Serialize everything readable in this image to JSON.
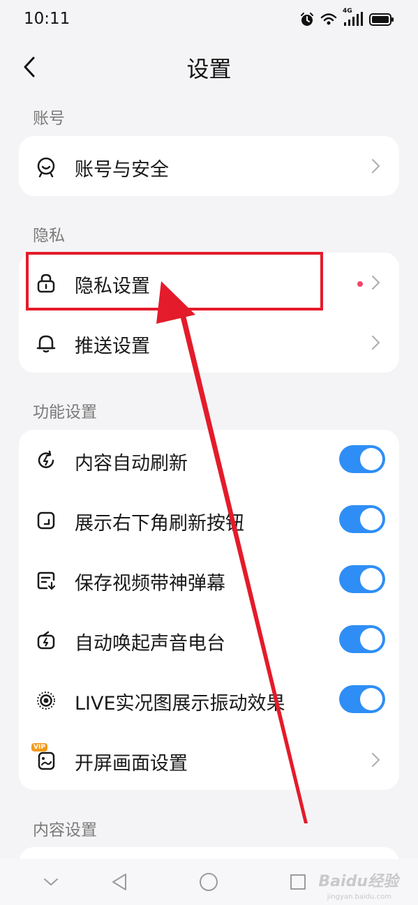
{
  "status_bar": {
    "time": "10:11",
    "network": "4G",
    "icons": [
      "alarm-icon",
      "wifi-icon",
      "signal-icon",
      "battery-icon"
    ]
  },
  "header": {
    "title": "设置",
    "back_icon": "back-arrow-icon"
  },
  "sections": {
    "account": {
      "label": "账号",
      "items": [
        {
          "label": "账号与安全",
          "icon": "face-id-icon",
          "control": "chevron"
        }
      ]
    },
    "privacy": {
      "label": "隐私",
      "items": [
        {
          "label": "隐私设置",
          "icon": "lock-icon",
          "control": "chevron",
          "badge": "red-dot"
        },
        {
          "label": "推送设置",
          "icon": "bell-icon",
          "control": "chevron"
        }
      ]
    },
    "features": {
      "label": "功能设置",
      "items": [
        {
          "label": "内容自动刷新",
          "icon": "refresh-icon",
          "control": "toggle",
          "on": true
        },
        {
          "label": "展示右下角刷新按钮",
          "icon": "corner-button-icon",
          "control": "toggle",
          "on": true
        },
        {
          "label": "保存视频带神弹幕",
          "icon": "danmaku-icon",
          "control": "toggle",
          "on": true
        },
        {
          "label": "自动唤起声音电台",
          "icon": "radio-icon",
          "control": "toggle",
          "on": true
        },
        {
          "label": "LIVE实况图展示振动效果",
          "icon": "live-photo-icon",
          "control": "toggle",
          "on": true
        },
        {
          "label": "开屏画面设置",
          "icon": "splash-screen-icon",
          "control": "chevron",
          "badge_text": "VIP"
        }
      ]
    },
    "content": {
      "label": "内容设置"
    }
  },
  "bottom_nav": {
    "icons": [
      "collapse-icon",
      "back-triangle-icon",
      "home-circle-icon",
      "recents-square-icon"
    ]
  },
  "watermark": {
    "text": "Baidu经验",
    "sub": "jingyan.baidu.com"
  },
  "colors": {
    "background": "#f4f4f6",
    "toggle_on": "#2f8ef5",
    "red_dot": "#f0466a",
    "annotation": "#e41b2a",
    "vip_badge": "#f29a1d"
  }
}
